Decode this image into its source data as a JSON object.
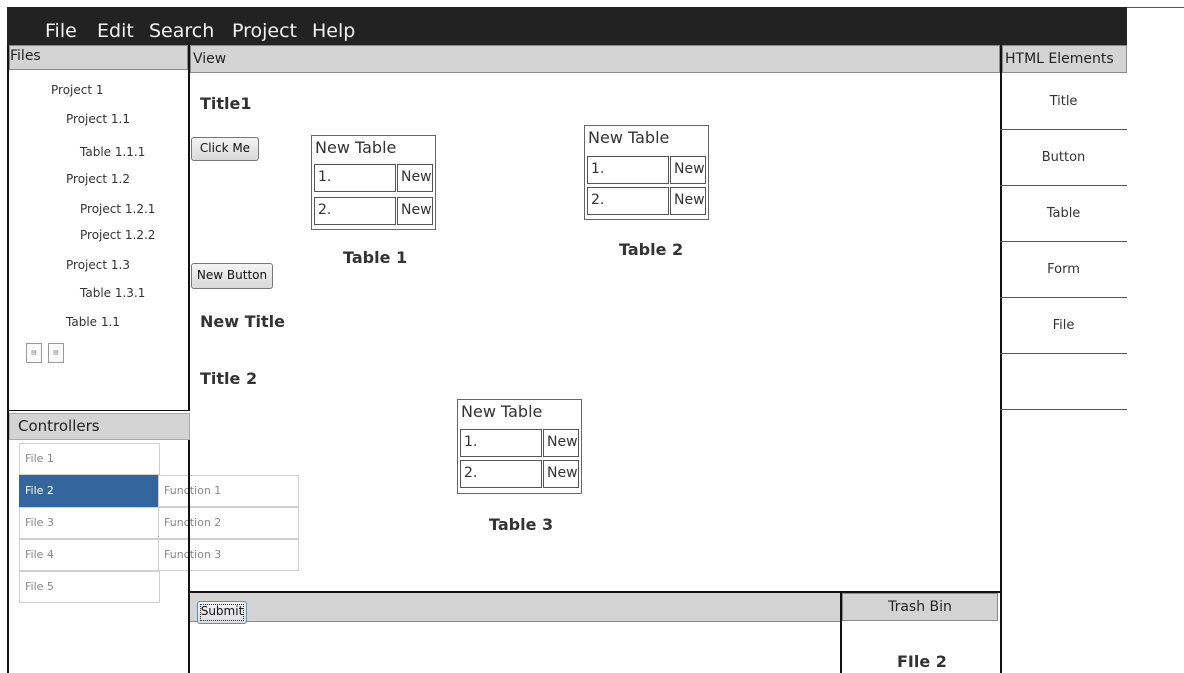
{
  "menu": {
    "items": [
      "File",
      "Edit",
      "Search",
      "Project",
      "Help"
    ]
  },
  "files": {
    "header": "Files",
    "tree": [
      "Project 1",
      "Project 1.1",
      "Table 1.1.1",
      "Project 1.2",
      "Project 1.2.1",
      "Project 1.2.2",
      "Project 1.3",
      "Table 1.3.1",
      "Table 1.1"
    ],
    "icons": [
      "file-icon",
      "file-icon"
    ]
  },
  "controllers": {
    "header": "Controllers",
    "files": [
      "File 1",
      "File 2",
      "File 3",
      "File 4",
      "File 5"
    ],
    "selected": "File 2",
    "functions": [
      "Function 1",
      "Function 2",
      "Function 3"
    ],
    "selected_color": "#34659d"
  },
  "view": {
    "header": "View",
    "titles": [
      "Title1",
      "New Title",
      "Title 2"
    ],
    "buttons": [
      "Click Me",
      "New Button"
    ],
    "tables": [
      {
        "title": "New Table",
        "rows": [
          [
            "1.",
            "New"
          ],
          [
            "2.",
            "New"
          ]
        ],
        "caption": "Table 1"
      },
      {
        "title": "New Table",
        "rows": [
          [
            "1.",
            "New"
          ],
          [
            "2.",
            "New"
          ]
        ],
        "caption": "Table 2"
      },
      {
        "title": "New Table",
        "rows": [
          [
            "1.",
            "New"
          ],
          [
            "2.",
            "New"
          ]
        ],
        "caption": "Table 3"
      }
    ]
  },
  "html_elements": {
    "header": "HTML Elements",
    "items": [
      "Title",
      "Button",
      "Table",
      "Form",
      "File"
    ]
  },
  "bottom": {
    "submit": "Submit",
    "trash_header": "Trash Bin",
    "trash_item": "FIle 2"
  }
}
